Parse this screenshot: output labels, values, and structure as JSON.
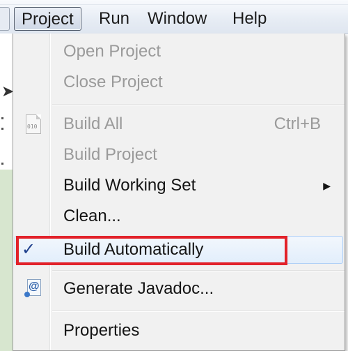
{
  "menubar": {
    "items": [
      {
        "label": "Project"
      },
      {
        "label": "Run"
      },
      {
        "label": "Window"
      },
      {
        "label": "Help"
      }
    ]
  },
  "menu": {
    "items": [
      {
        "label": "Open Project",
        "enabled": false
      },
      {
        "label": "Close Project",
        "enabled": false
      },
      {
        "label": "Build All",
        "accelerator": "Ctrl+B",
        "enabled": false,
        "icon": "build-all-binary-icon"
      },
      {
        "label": "Build Project",
        "enabled": false
      },
      {
        "label": "Build Working Set",
        "enabled": true,
        "submenu_icon": "submenu-arrow-icon"
      },
      {
        "label": "Clean...",
        "enabled": true
      },
      {
        "label": "Build Automatically",
        "enabled": true,
        "checked": true,
        "check_glyph": "✓",
        "highlight_color": "#e2222a"
      },
      {
        "label": "Generate Javadoc...",
        "enabled": true,
        "icon": "javadoc-icon"
      },
      {
        "label": "Properties",
        "enabled": true
      }
    ],
    "submenu_glyph": "▶"
  }
}
